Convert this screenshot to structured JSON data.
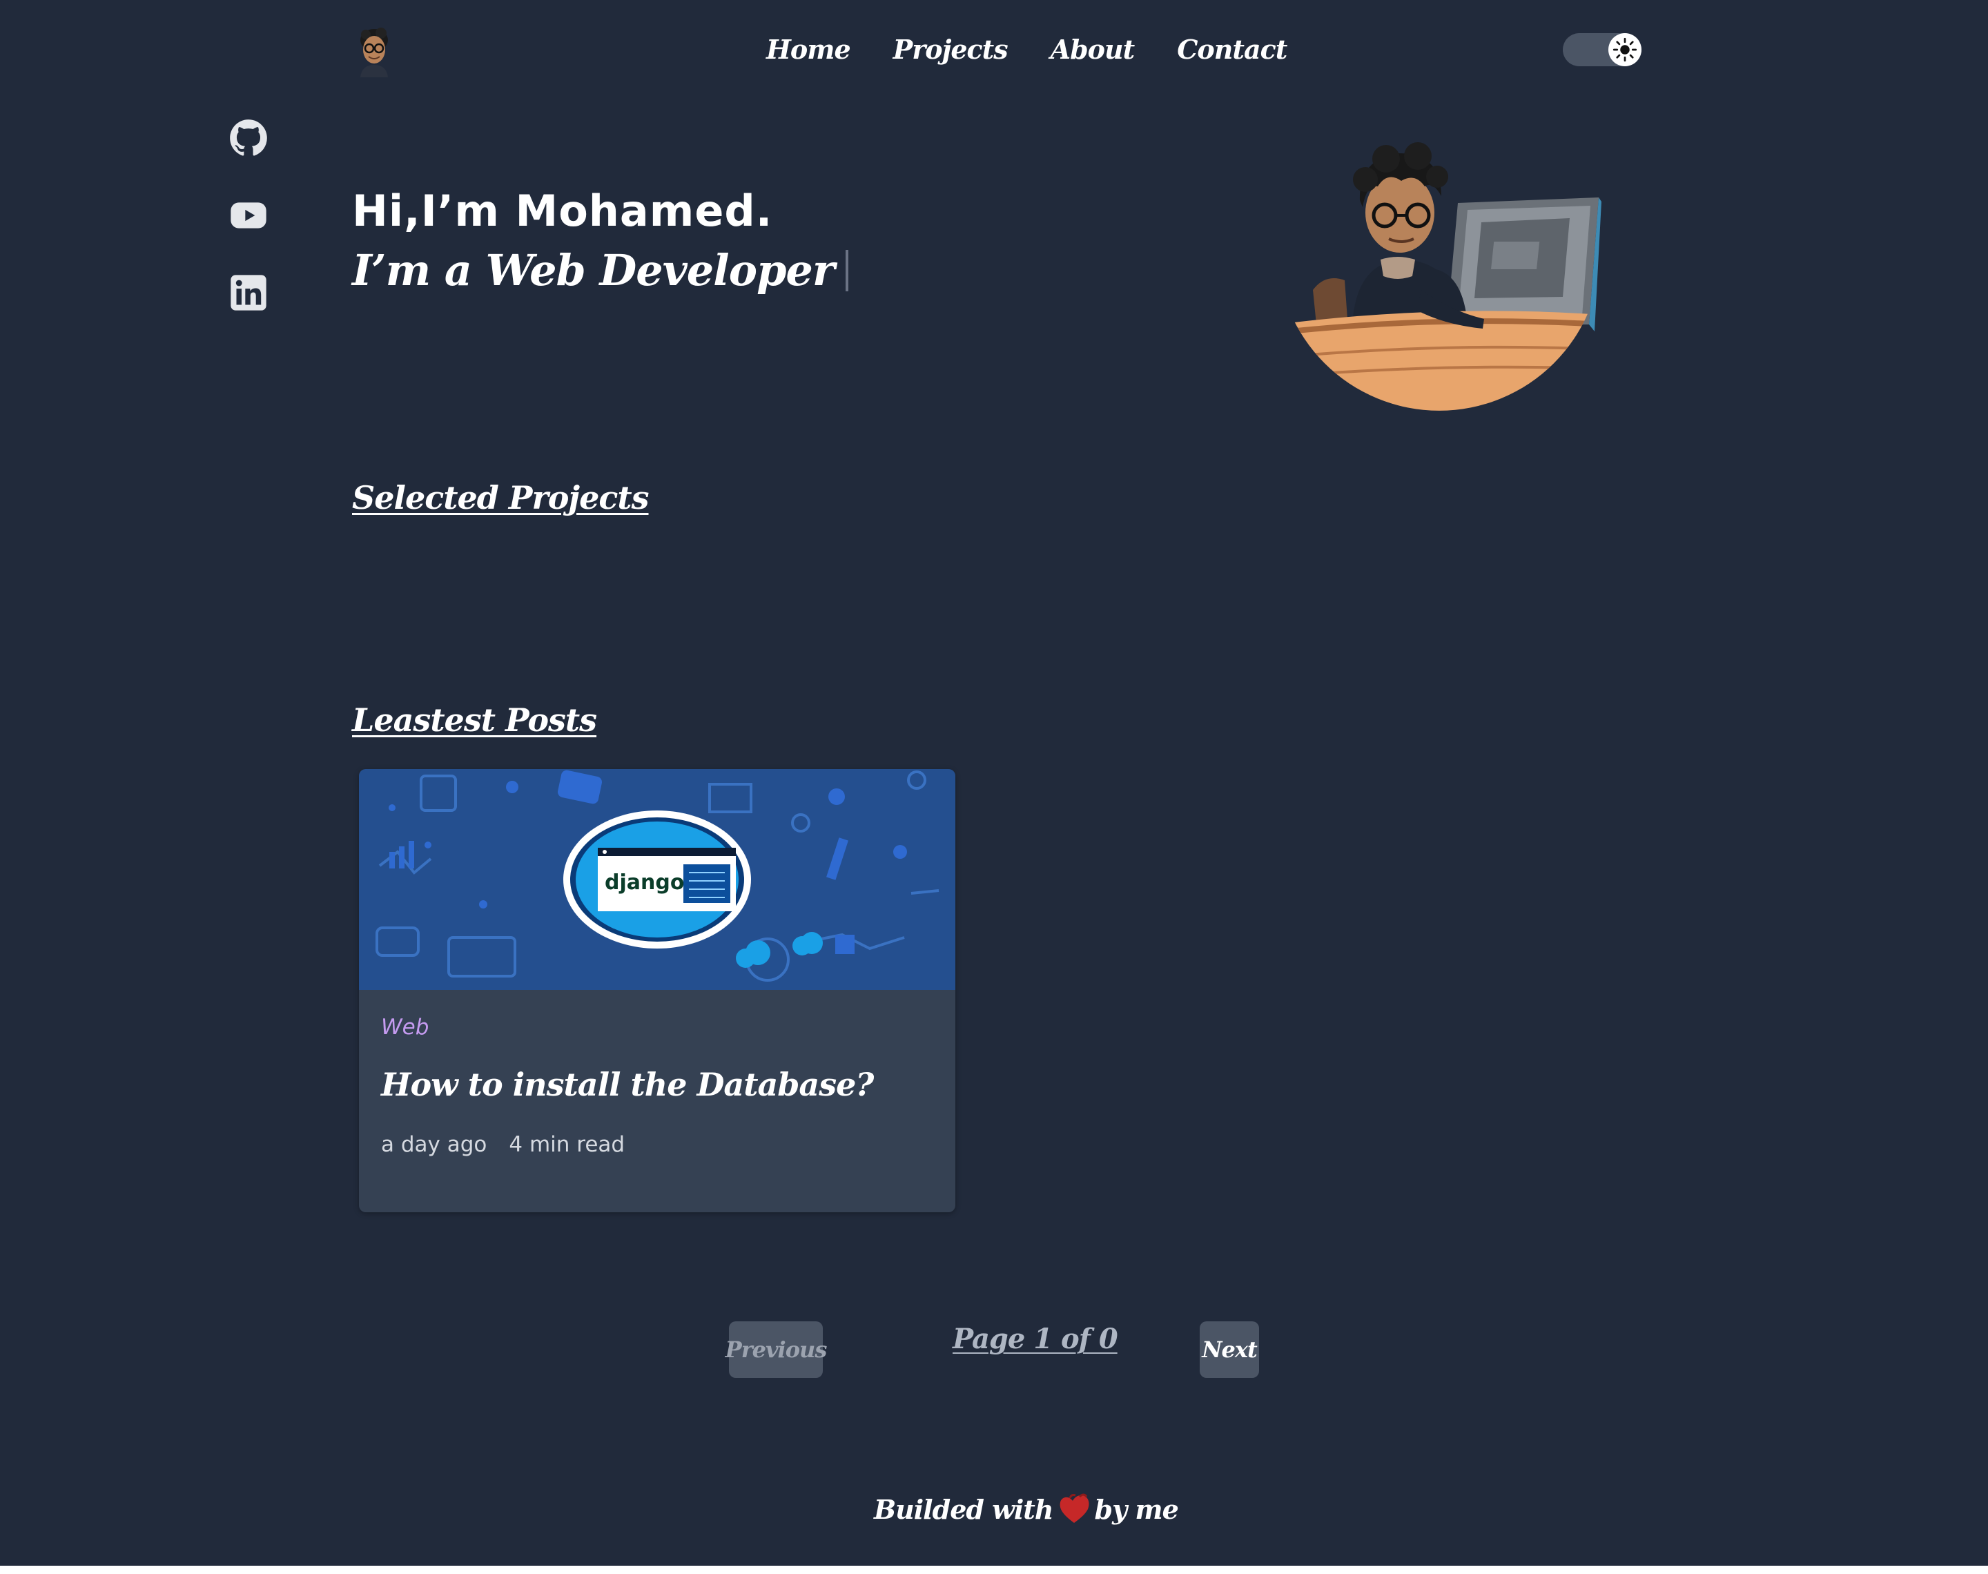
{
  "nav": {
    "links": [
      {
        "label": "Home"
      },
      {
        "label": "Projects"
      },
      {
        "label": "About"
      },
      {
        "label": "Contact"
      }
    ]
  },
  "social": {
    "icons": [
      "github-icon",
      "youtube-icon",
      "linkedin-icon"
    ]
  },
  "hero": {
    "greeting": "Hi,I’m Mohamed.",
    "role_line": "I’m a Web Developer"
  },
  "sections": {
    "projects_title": "Selected Projects",
    "posts_title": "Leastest Posts"
  },
  "posts": [
    {
      "category": "Web",
      "title": "How to install the Database?",
      "date": "a day ago",
      "read_time": "4 min read",
      "thumbnail_text": "django"
    }
  ],
  "pagination": {
    "previous_label": "Previous",
    "page_text": "Page 1 of 0",
    "next_label": "Next"
  },
  "footer": {
    "before": "Builded with",
    "after": "by me"
  },
  "colors": {
    "background": "#212a3b",
    "card": "#354153",
    "category": "#c59bf0",
    "button": "#4b5565",
    "heart": "#d32f2f"
  }
}
